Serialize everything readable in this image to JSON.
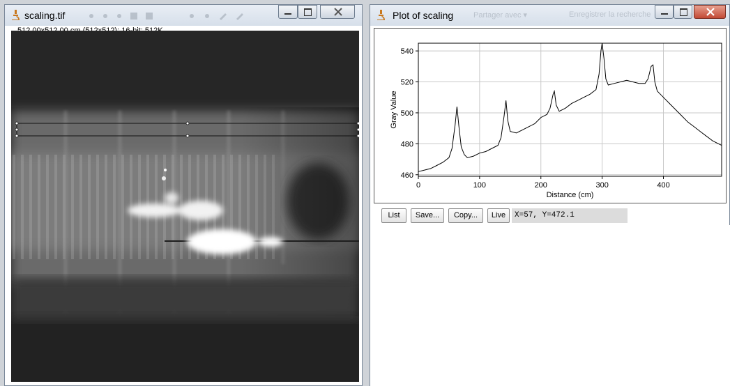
{
  "image_window": {
    "title": "scaling.tif",
    "info": "512.00x512.00 cm (512x512); 16-bit; 512K"
  },
  "plot_window": {
    "title": "Plot of scaling",
    "toolbar_faded": [
      "Partager avec ▾",
      "Enregistrer la recherche"
    ],
    "buttons": {
      "list": "List",
      "save": "Save...",
      "copy": "Copy...",
      "live": "Live"
    },
    "coordinates": "X=57, Y=472.1"
  },
  "chart_data": {
    "type": "line",
    "xlabel": "Distance (cm)",
    "ylabel": "Gray Value",
    "xlim": [
      0,
      495
    ],
    "ylim": [
      459,
      545
    ],
    "xticks": [
      0,
      100,
      200,
      300,
      400
    ],
    "yticks": [
      460,
      480,
      500,
      520,
      540
    ],
    "grid": true,
    "series": [
      {
        "x": [
          0,
          10,
          20,
          30,
          40,
          50,
          55,
          60,
          63,
          66,
          70,
          75,
          80,
          90,
          100,
          110,
          120,
          130,
          135,
          140,
          143,
          146,
          150,
          160,
          170,
          180,
          190,
          200,
          210,
          215,
          220,
          222,
          225,
          230,
          240,
          250,
          260,
          270,
          280,
          290,
          295,
          298,
          300,
          303,
          306,
          310,
          320,
          330,
          340,
          350,
          360,
          370,
          375,
          380,
          383,
          386,
          390,
          400,
          410,
          420,
          430,
          440,
          450,
          460,
          470,
          480,
          490,
          495
        ],
        "y": [
          462,
          463,
          464,
          466,
          468,
          471,
          477,
          492,
          504,
          492,
          478,
          473,
          471,
          472,
          474,
          475,
          477,
          479,
          484,
          498,
          508,
          495,
          488,
          487,
          489,
          491,
          493,
          497,
          499,
          503,
          512,
          514,
          505,
          501,
          503,
          506,
          508,
          510,
          512,
          515,
          525,
          540,
          545,
          535,
          522,
          518,
          519,
          520,
          521,
          520,
          519,
          519,
          522,
          530,
          531,
          520,
          514,
          510,
          506,
          502,
          498,
          494,
          491,
          488,
          485,
          482,
          480,
          479
        ]
      }
    ]
  }
}
